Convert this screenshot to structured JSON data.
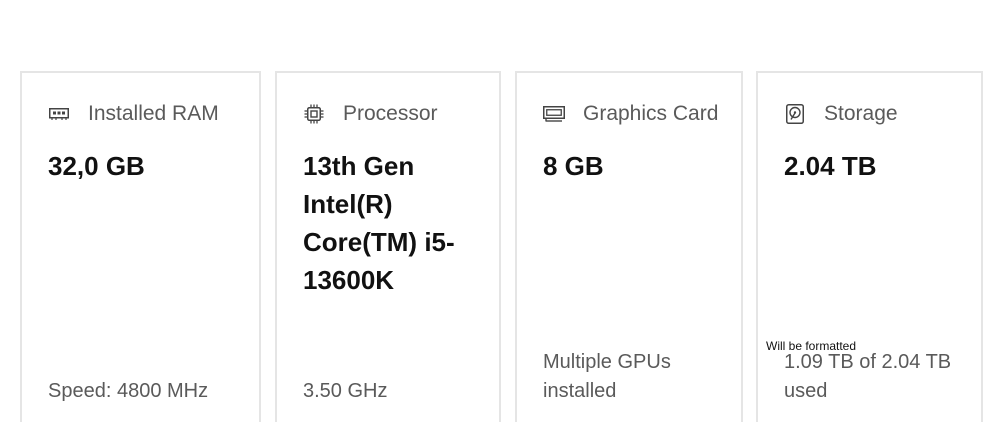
{
  "specs": {
    "ram": {
      "icon": "ram-icon",
      "label": "Installed RAM",
      "value": "32,0 GB",
      "footer": "Speed: 4800 MHz"
    },
    "cpu": {
      "icon": "processor-icon",
      "label": "Processor",
      "value": "13th Gen Intel(R) Core(TM) i5-13600K",
      "footer": "3.50 GHz"
    },
    "gpu": {
      "icon": "graphics-card-icon",
      "label": "Graphics Card",
      "value": "8 GB",
      "footer": "Multiple GPUs installed"
    },
    "storage": {
      "icon": "storage-icon",
      "label": "Storage",
      "value": "2.04 TB",
      "note": "Will be formatted",
      "footer": "1.09 TB of 2.04 TB used"
    }
  }
}
